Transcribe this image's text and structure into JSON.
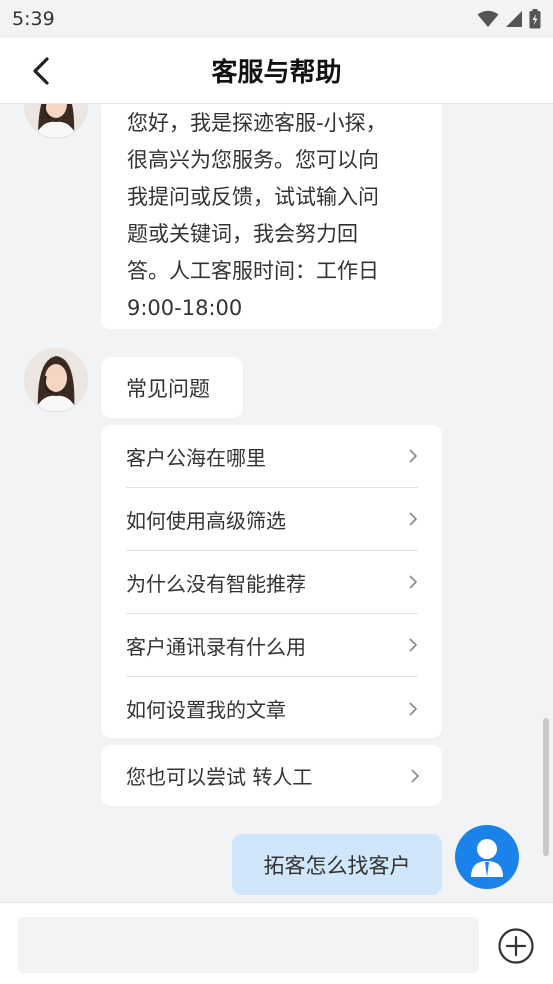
{
  "status_bar": {
    "time": "5:39"
  },
  "header": {
    "title": "客服与帮助"
  },
  "messages": {
    "welcome": [
      "您好，我是探迹客服-小探，",
      "很高兴为您服务。您可以向",
      "我提问或反馈，试试输入问",
      "题或关键词，我会努力回",
      "答。人工客服时间：工作日",
      "9:00-18:00"
    ],
    "faq_title": "常见问题",
    "faq_items": [
      "客户公海在哪里",
      "如何使用高级筛选",
      "为什么没有智能推荐",
      "客户通讯录有什么用",
      "如何设置我的文章"
    ],
    "transfer": "您也可以尝试 转人工",
    "user_message": "拓客怎么找客户"
  },
  "input": {
    "placeholder": ""
  }
}
